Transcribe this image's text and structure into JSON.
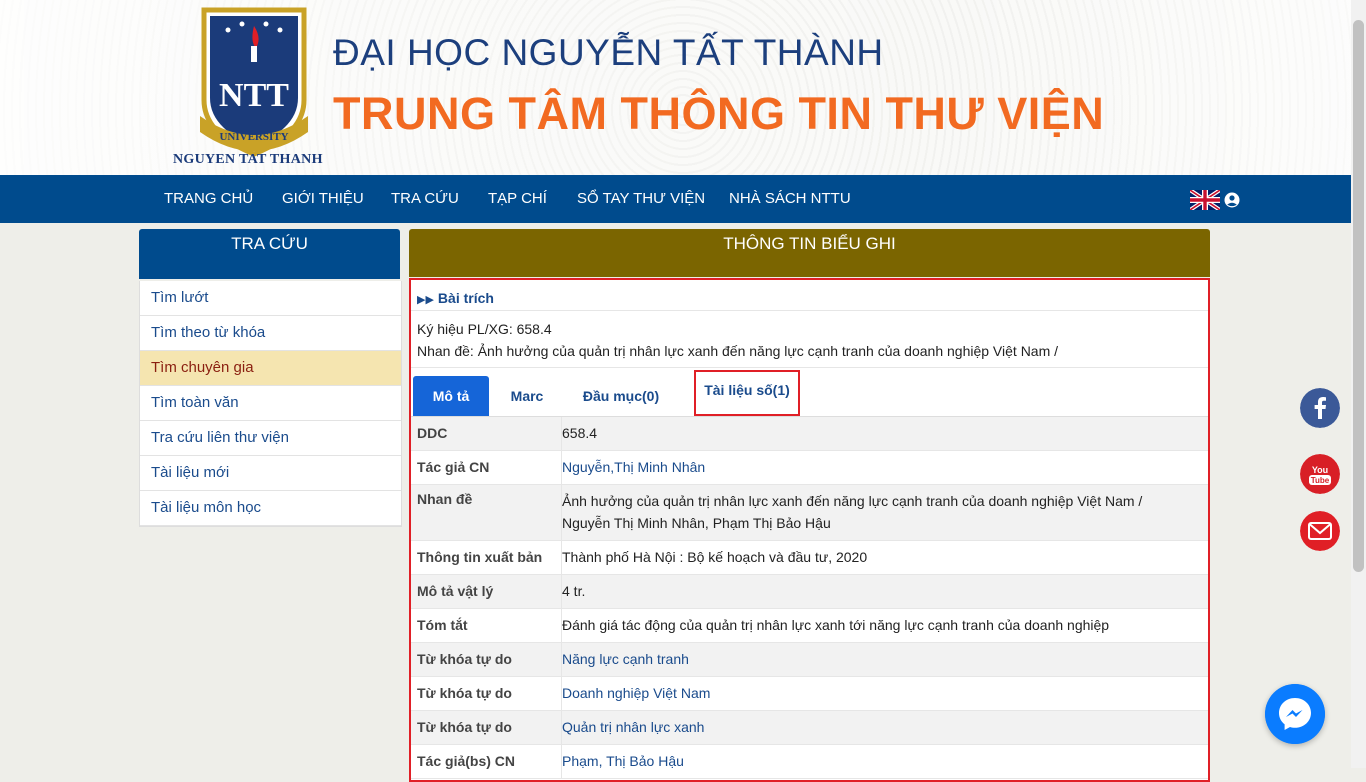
{
  "header": {
    "university": "ĐẠI HỌC NGUYỄN TẤT THÀNH",
    "center": "TRUNG TÂM THÔNG TIN THƯ VIỆN",
    "logo_caption": "NGUYEN TAT THANH",
    "logo_band": "UNIVERSITY",
    "logo_letters": "NTT"
  },
  "nav": {
    "items": [
      "TRANG CHỦ",
      "GIỚI THIỆU",
      "TRA CỨU",
      "TẠP CHÍ",
      "SỔ TAY THƯ VIỆN",
      "NHÀ SÁCH NTTU"
    ]
  },
  "sidebar": {
    "title": "TRA CỨU",
    "items": [
      "Tìm lướt",
      "Tìm theo từ khóa",
      "Tìm chuyên gia",
      "Tìm toàn văn",
      "Tra cứu liên thư viện",
      "Tài liệu mới",
      "Tài liệu môn học"
    ],
    "active_index": 2
  },
  "record": {
    "panel_title": "THÔNG TIN BIỂU GHI",
    "section": "Bài trích",
    "call_number": "Ký hiệu PL/XG: 658.4",
    "title_line": "Nhan đề: Ảnh hưởng của quản trị nhân lực xanh đến năng lực cạnh tranh của doanh nghiệp Việt Nam /",
    "tabs": [
      "Mô tả",
      "Marc",
      "Đầu mục(0)",
      "Tài liệu số(1)"
    ],
    "fields": [
      {
        "k": "DDC",
        "v": "658.4"
      },
      {
        "k": "Tác giả CN",
        "v": "Nguyễn,Thị Minh Nhân"
      },
      {
        "k": "Nhan đề",
        "v": "Ảnh hưởng của quản trị nhân lực xanh đến năng lực cạnh tranh của doanh nghiệp Việt Nam /",
        "v2": "Nguyễn Thị Minh Nhân, Phạm Thị Bảo Hậu"
      },
      {
        "k": "Thông tin xuất bản",
        "v": "Thành phố Hà Nội : Bộ kế hoạch và đầu tư, 2020"
      },
      {
        "k": "Mô tả vật lý",
        "v": "4 tr."
      },
      {
        "k": "Tóm tắt",
        "v": "Đánh giá tác động của quản trị nhân lực xanh tới năng lực cạnh tranh của doanh nghiệp"
      },
      {
        "k": "Từ khóa tự do",
        "v": "Năng lực cạnh tranh"
      },
      {
        "k": "Từ khóa tự do",
        "v": "Doanh nghiệp Việt Nam"
      },
      {
        "k": "Từ khóa tự do",
        "v": "Quản trị nhân lực xanh"
      },
      {
        "k": "Tác giả(bs) CN",
        "v": "Phạm, Thị Bảo Hậu"
      }
    ]
  },
  "colors": {
    "nav_blue": "#004b8d",
    "accent_orange": "#f26a21",
    "panel_olive": "#7b6500",
    "highlight_red": "#e01f26"
  },
  "icons": [
    "uk-flag-icon",
    "user-icon",
    "facebook-icon",
    "youtube-icon",
    "mail-icon",
    "messenger-icon",
    "play-arrows-icon"
  ]
}
